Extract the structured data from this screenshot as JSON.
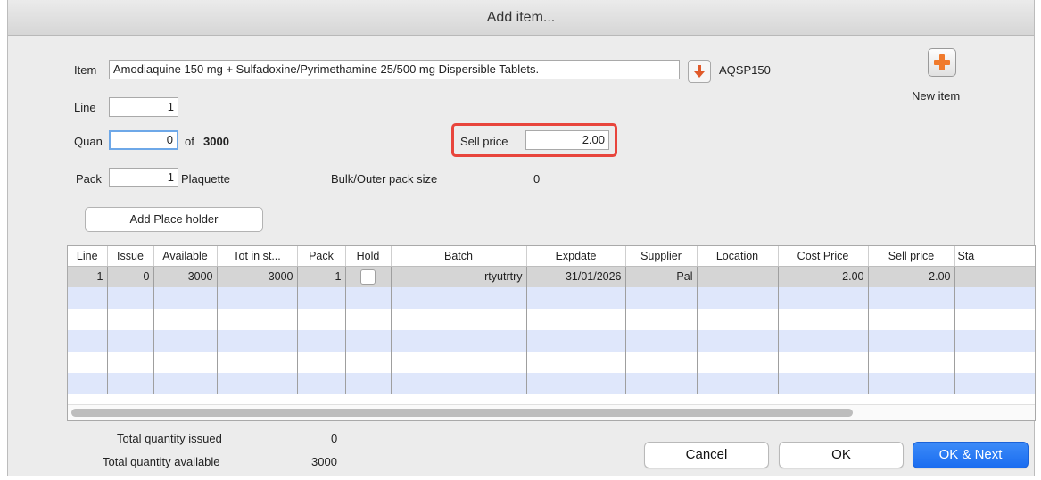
{
  "window": {
    "title": "Add item..."
  },
  "item": {
    "label": "Item",
    "value": "Amodiaquine 150 mg + Sulfadoxine/Pyrimethamine 25/500 mg Dispersible Tablets.",
    "code": "AQSP150"
  },
  "line": {
    "label": "Line",
    "value": "1"
  },
  "quan": {
    "label": "Quan",
    "value": "0",
    "of_label": "of",
    "of_value": "3000"
  },
  "sell_price": {
    "label": "Sell price",
    "value": "2.00"
  },
  "pack": {
    "label": "Pack",
    "value": "1",
    "unit": "Plaquette"
  },
  "bulk": {
    "label": "Bulk/Outer pack size",
    "value": "0"
  },
  "new_item": {
    "label": "New item"
  },
  "place_holder_button": "Add Place holder",
  "table": {
    "columns": [
      "Line",
      "Issue",
      "Available",
      "Tot in st...",
      "Pack",
      "Hold",
      "Batch",
      "Expdate",
      "Supplier",
      "Location",
      "Cost Price",
      "Sell price",
      "Sta"
    ],
    "rows": [
      {
        "line": "1",
        "issue": "0",
        "available": "3000",
        "tot": "3000",
        "pack": "1",
        "batch": "rtyutrtry",
        "expdate": "31/01/2026",
        "supplier": "Pal",
        "location": "",
        "cost": "2.00",
        "sell": "2.00",
        "sta": ""
      }
    ]
  },
  "totals": {
    "issued_label": "Total quantity issued",
    "issued_value": "0",
    "available_label": "Total quantity available",
    "available_value": "3000"
  },
  "buttons": {
    "cancel": "Cancel",
    "ok": "OK",
    "ok_next": "OK & Next"
  },
  "colors": {
    "accent_blue": "#1a6cf0",
    "highlight_red": "#e8453c",
    "row_alt": "#dfe7fb",
    "new_item_orange": "#f07a2c"
  },
  "icons": {
    "download": "download-arrow-icon",
    "new_item": "plus-icon"
  }
}
